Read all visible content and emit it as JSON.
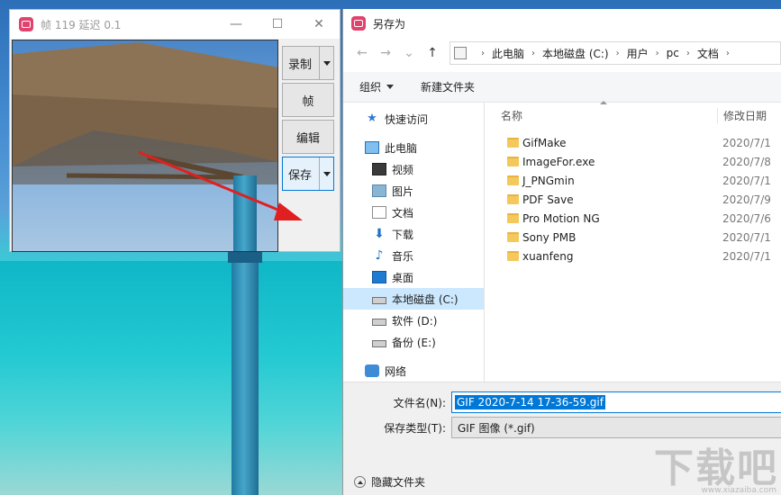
{
  "frame_window": {
    "title": "帧 119 延迟 0.1",
    "minimize": "—",
    "maximize": "☐",
    "close": "✕",
    "buttons": {
      "record": "录制",
      "frame": "帧",
      "edit": "编辑",
      "save": "保存"
    }
  },
  "save_dialog": {
    "title": "另存为",
    "nav": {
      "back": "←",
      "forward": "→",
      "dropdown": "⌄",
      "up": "↑"
    },
    "breadcrumbs": [
      "此电脑",
      "本地磁盘 (C:)",
      "用户",
      "pc",
      "文档"
    ],
    "toolbar": {
      "organize": "组织",
      "new_folder": "新建文件夹"
    },
    "nav_pane": {
      "quick_access": "快速访问",
      "this_pc": "此电脑",
      "videos": "视频",
      "pictures": "图片",
      "documents": "文档",
      "downloads": "下载",
      "music": "音乐",
      "desktop": "桌面",
      "local_disk": "本地磁盘 (C:)",
      "software": "软件 (D:)",
      "backup": "备份 (E:)",
      "network": "网络"
    },
    "columns": {
      "name": "名称",
      "date": "修改日期"
    },
    "files": [
      {
        "name": "GifMake",
        "date": "2020/7/1"
      },
      {
        "name": "ImageFor.exe",
        "date": "2020/7/8"
      },
      {
        "name": "J_PNGmin",
        "date": "2020/7/1"
      },
      {
        "name": "PDF Save",
        "date": "2020/7/9"
      },
      {
        "name": "Pro Motion NG",
        "date": "2020/7/6"
      },
      {
        "name": "Sony PMB",
        "date": "2020/7/1"
      },
      {
        "name": "xuanfeng",
        "date": "2020/7/1"
      }
    ],
    "filename_label": "文件名(N):",
    "filename_value": "GIF 2020-7-14 17-36-59.gif",
    "filetype_label": "保存类型(T):",
    "filetype_value": "GIF 图像 (*.gif)",
    "hide_folders": "隐藏文件夹"
  },
  "watermark": {
    "text": "下载吧",
    "sub": "www.xiazaiba.com"
  },
  "colors": {
    "accent": "#0078d7",
    "selection": "#cce8ff",
    "app_icon": "#e0436e",
    "arrow": "#e02020"
  }
}
